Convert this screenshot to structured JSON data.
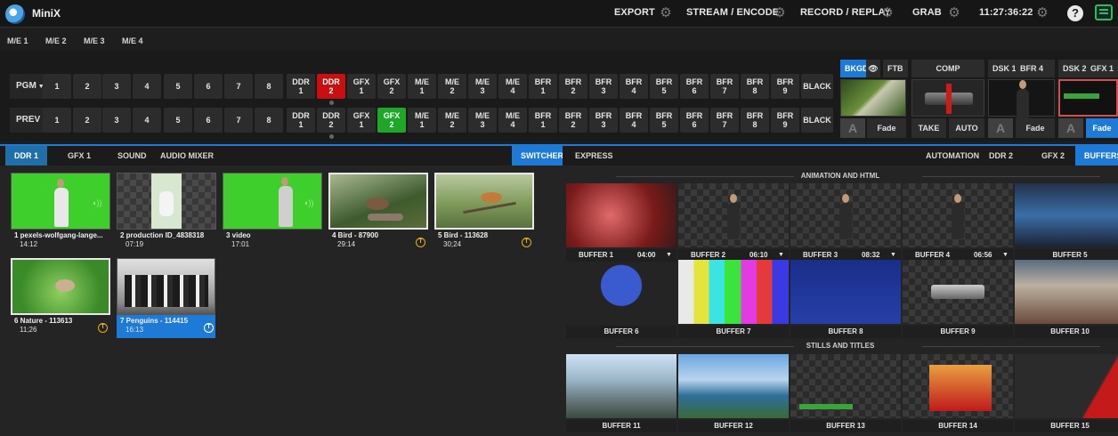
{
  "app": {
    "title": "MiniX"
  },
  "topbar": {
    "export": "EXPORT",
    "stream": "STREAM / ENCODE",
    "record": "RECORD / REPLAY",
    "grab": "GRAB",
    "clock": "11:27:36:22"
  },
  "me_tabs": [
    "M/E 1",
    "M/E 2",
    "M/E 3",
    "M/E 4"
  ],
  "rows": {
    "pgm_label": "PGM",
    "prev_label": "PREV",
    "numbers": [
      "1",
      "2",
      "3",
      "4",
      "5",
      "6",
      "7",
      "8"
    ],
    "sources_line1": [
      "DDR",
      "DDR",
      "GFX",
      "GFX",
      "M/E",
      "M/E",
      "M/E",
      "M/E",
      "BFR",
      "BFR",
      "BFR",
      "BFR",
      "BFR",
      "BFR",
      "BFR",
      "BFR",
      "BFR"
    ],
    "sources_line2": [
      "1",
      "2",
      "1",
      "2",
      "1",
      "2",
      "3",
      "4",
      "1",
      "2",
      "3",
      "4",
      "5",
      "6",
      "7",
      "8",
      "9"
    ],
    "black": "BLACK",
    "pgm_active": "DDR 2",
    "prev_active": "GFX 2"
  },
  "controls": {
    "bkgd": "BKGD",
    "ftb": "FTB",
    "fade": "Fade",
    "comp": "COMP",
    "take": "TAKE",
    "auto": "AUTO",
    "dsk1": "DSK 1",
    "bfr4": "BFR 4",
    "dsk2": "DSK 2",
    "gfx1": "GFX 1",
    "dsk1_fade": "Fade",
    "dsk2_fade": "Fade"
  },
  "left_tabs": [
    "DDR 1",
    "GFX 1",
    "SOUND",
    "AUDIO MIXER",
    "SWITCHER"
  ],
  "right_tabs": [
    "EXPRESS",
    "AUTOMATION",
    "DDR 2",
    "GFX 2",
    "BUFFERS"
  ],
  "media": [
    {
      "name": "1 pexels-wolfgang-lange...",
      "duration": "14:12"
    },
    {
      "name": "2 production ID_4838318",
      "duration": "07:19"
    },
    {
      "name": "3 video",
      "duration": "17:01"
    },
    {
      "name": "4 Bird - 87900",
      "duration": "29:14"
    },
    {
      "name": "5 Bird - 113628",
      "duration": "30;24"
    },
    {
      "name": "6 Nature - 113613",
      "duration": "11;26"
    },
    {
      "name": "7 Penguins - 114415",
      "duration": "16:13"
    }
  ],
  "sections": {
    "animation": "ANIMATION AND HTML",
    "stills": "STILLS AND TITLES"
  },
  "buffers": [
    {
      "name": "BUFFER 1",
      "time": "04:00"
    },
    {
      "name": "BUFFER 2",
      "time": "06:10"
    },
    {
      "name": "BUFFER 3",
      "time": "08:32"
    },
    {
      "name": "BUFFER 4",
      "time": "06:56"
    },
    {
      "name": "BUFFER 5",
      "time": ""
    },
    {
      "name": "BUFFER 6",
      "time": ""
    },
    {
      "name": "BUFFER 7",
      "time": ""
    },
    {
      "name": "BUFFER 8",
      "time": ""
    },
    {
      "name": "BUFFER 9",
      "time": ""
    },
    {
      "name": "BUFFER 10",
      "time": ""
    },
    {
      "name": "BUFFER 11",
      "time": ""
    },
    {
      "name": "BUFFER 12",
      "time": ""
    },
    {
      "name": "BUFFER 13",
      "time": ""
    },
    {
      "name": "BUFFER 14",
      "time": ""
    },
    {
      "name": "BUFFER 15",
      "time": ""
    }
  ],
  "colors": {
    "accent": "#1d7ad6",
    "program": "#c81010",
    "preview": "#1fa827"
  }
}
